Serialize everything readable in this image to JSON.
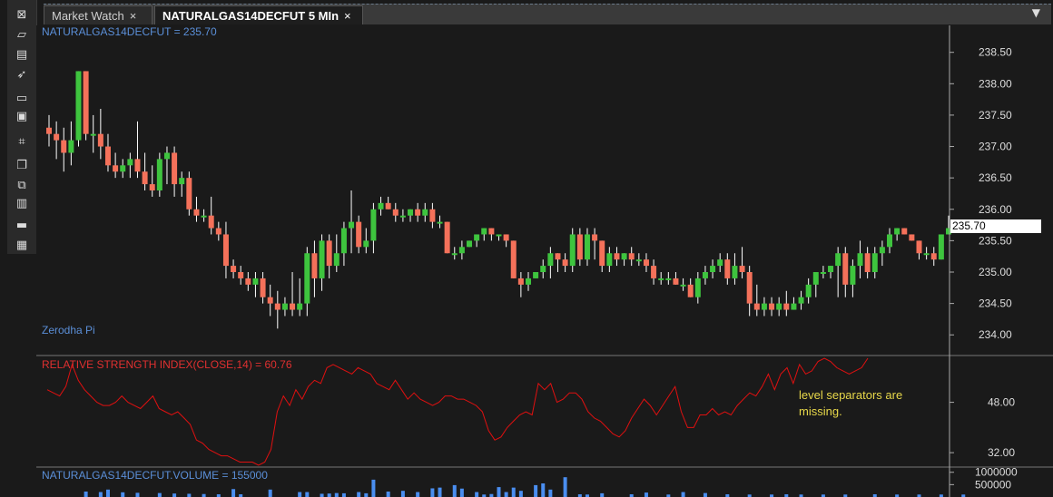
{
  "tabs": [
    {
      "label": "Market Watch",
      "close": "×",
      "active": false
    },
    {
      "label": "NATURALGAS14DECFUT 5 MIn",
      "close": "×",
      "active": true
    }
  ],
  "dropdown_icon": "chevron-down-icon",
  "toolbar": {
    "icons": [
      "close-window-icon",
      "open-folder-icon",
      "chart-icon",
      "rocket-icon",
      "window-icon",
      "save-icon",
      "crosshair-icon",
      "book-icon",
      "reading-icon",
      "briefcase-icon",
      "bar-icon",
      "list-icon"
    ]
  },
  "price_panel": {
    "title": "NATURALGAS14DECFUT = 235.70",
    "watermark": "Zerodha Pi",
    "current_price": "235.70",
    "axis_labels": [
      "238.50",
      "238.00",
      "237.50",
      "237.00",
      "236.50",
      "236.00",
      "235.50",
      "235.00",
      "234.50",
      "234.00"
    ]
  },
  "rsi_panel": {
    "title": "RELATIVE STRENGTH INDEX(CLOSE,14) = 60.76",
    "axis_labels": [
      "48.00",
      "32.00"
    ]
  },
  "volume_panel": {
    "title": "NATURALGAS14DECFUT.VOLUME = 155000",
    "axis_labels": [
      "1000000",
      "500000"
    ]
  },
  "annotation": "level separators are missing.",
  "colors": {
    "up": "#3ec43e",
    "down": "#f4715a",
    "rsi": "#e01010",
    "volume": "#4a8ef0",
    "price_title": "#5b8fd8",
    "rsi_title": "#e03030"
  },
  "chart_data": [
    {
      "type": "candlestick",
      "title": "NATURALGAS14DECFUT = 235.70",
      "ylim": [
        233.7,
        238.9
      ],
      "candles": [
        [
          237.3,
          237.5,
          237.0,
          237.2
        ],
        [
          237.2,
          237.4,
          236.8,
          237.1
        ],
        [
          237.1,
          237.3,
          236.6,
          236.9
        ],
        [
          236.9,
          237.4,
          236.7,
          237.1
        ],
        [
          237.1,
          238.2,
          237.0,
          238.2
        ],
        [
          238.2,
          238.2,
          237.1,
          237.2
        ],
        [
          237.2,
          237.5,
          236.9,
          237.2
        ],
        [
          237.2,
          237.6,
          236.8,
          237.0
        ],
        [
          237.0,
          237.2,
          236.6,
          236.7
        ],
        [
          236.7,
          236.9,
          236.5,
          236.6
        ],
        [
          236.6,
          236.8,
          236.5,
          236.7
        ],
        [
          236.7,
          236.9,
          236.5,
          236.8
        ],
        [
          236.8,
          237.4,
          236.5,
          236.6
        ],
        [
          236.6,
          236.9,
          236.3,
          236.4
        ],
        [
          236.4,
          236.7,
          236.2,
          236.3
        ],
        [
          236.3,
          236.9,
          236.2,
          236.8
        ],
        [
          236.8,
          237.0,
          236.4,
          236.9
        ],
        [
          236.9,
          237.0,
          236.2,
          236.4
        ],
        [
          236.4,
          236.6,
          236.2,
          236.5
        ],
        [
          236.5,
          236.6,
          235.9,
          236.0
        ],
        [
          236.0,
          236.2,
          235.8,
          235.9
        ],
        [
          235.9,
          236.0,
          235.8,
          235.9
        ],
        [
          235.9,
          236.2,
          235.6,
          235.7
        ],
        [
          235.7,
          235.8,
          235.5,
          235.6
        ],
        [
          235.6,
          235.8,
          234.9,
          235.1
        ],
        [
          235.1,
          235.2,
          234.9,
          235.0
        ],
        [
          235.0,
          235.1,
          234.8,
          234.9
        ],
        [
          234.9,
          235.0,
          234.7,
          234.8
        ],
        [
          234.8,
          235.0,
          234.6,
          234.9
        ],
        [
          234.9,
          235.0,
          234.5,
          234.6
        ],
        [
          234.6,
          234.8,
          234.3,
          234.5
        ],
        [
          234.5,
          234.7,
          234.1,
          234.4
        ],
        [
          234.4,
          234.6,
          234.3,
          234.5
        ],
        [
          234.5,
          235.0,
          234.3,
          234.4
        ],
        [
          234.4,
          234.9,
          234.3,
          234.5
        ],
        [
          234.5,
          235.4,
          234.3,
          235.3
        ],
        [
          235.3,
          235.5,
          234.6,
          234.9
        ],
        [
          234.9,
          235.6,
          234.7,
          235.5
        ],
        [
          235.5,
          235.6,
          234.9,
          235.1
        ],
        [
          235.1,
          235.6,
          235.0,
          235.3
        ],
        [
          235.3,
          235.8,
          235.1,
          235.7
        ],
        [
          235.7,
          236.3,
          235.3,
          235.8
        ],
        [
          235.8,
          235.9,
          235.3,
          235.4
        ],
        [
          235.4,
          235.7,
          235.3,
          235.5
        ],
        [
          235.5,
          236.1,
          235.3,
          236.0
        ],
        [
          236.0,
          236.2,
          235.9,
          236.1
        ],
        [
          236.1,
          236.2,
          236.0,
          236.0
        ],
        [
          236.0,
          236.1,
          235.8,
          235.9
        ],
        [
          235.9,
          236.0,
          235.8,
          235.9
        ],
        [
          235.9,
          236.0,
          235.8,
          236.0
        ],
        [
          236.0,
          236.1,
          235.8,
          235.9
        ],
        [
          235.9,
          236.1,
          235.8,
          236.0
        ],
        [
          236.0,
          236.1,
          235.7,
          235.8
        ],
        [
          235.8,
          235.9,
          235.7,
          235.8
        ],
        [
          235.8,
          235.8,
          235.3,
          235.3
        ],
        [
          235.3,
          235.4,
          235.2,
          235.3
        ],
        [
          235.3,
          235.5,
          235.2,
          235.4
        ],
        [
          235.4,
          235.5,
          235.4,
          235.5
        ],
        [
          235.5,
          235.6,
          235.4,
          235.6
        ],
        [
          235.6,
          235.7,
          235.5,
          235.7
        ],
        [
          235.7,
          235.7,
          235.5,
          235.6
        ],
        [
          235.6,
          235.6,
          235.5,
          235.6
        ],
        [
          235.6,
          235.6,
          235.4,
          235.5
        ],
        [
          235.5,
          235.5,
          234.9,
          234.9
        ],
        [
          234.9,
          235.0,
          234.6,
          234.8
        ],
        [
          234.8,
          235.0,
          234.7,
          234.9
        ],
        [
          234.9,
          235.0,
          234.9,
          235.0
        ],
        [
          235.0,
          235.2,
          234.9,
          235.1
        ],
        [
          235.1,
          235.4,
          234.9,
          235.3
        ],
        [
          235.3,
          235.3,
          235.0,
          235.2
        ],
        [
          235.2,
          235.3,
          235.0,
          235.1
        ],
        [
          235.1,
          235.7,
          235.0,
          235.6
        ],
        [
          235.6,
          235.7,
          235.1,
          235.2
        ],
        [
          235.2,
          235.7,
          235.1,
          235.6
        ],
        [
          235.6,
          235.7,
          235.2,
          235.5
        ],
        [
          235.5,
          235.5,
          235.0,
          235.1
        ],
        [
          235.1,
          235.4,
          235.0,
          235.3
        ],
        [
          235.3,
          235.4,
          235.1,
          235.2
        ],
        [
          235.2,
          235.3,
          235.1,
          235.3
        ],
        [
          235.3,
          235.4,
          235.1,
          235.2
        ],
        [
          235.2,
          235.3,
          235.1,
          235.2
        ],
        [
          235.2,
          235.3,
          235.0,
          235.1
        ],
        [
          235.1,
          235.2,
          234.8,
          234.9
        ],
        [
          234.9,
          235.0,
          234.8,
          234.9
        ],
        [
          234.9,
          235.0,
          234.8,
          234.9
        ],
        [
          234.9,
          235.0,
          234.8,
          234.8
        ],
        [
          234.8,
          234.9,
          234.7,
          234.8
        ],
        [
          234.8,
          234.9,
          234.6,
          234.6
        ],
        [
          234.6,
          235.0,
          234.5,
          234.9
        ],
        [
          234.9,
          235.1,
          234.8,
          235.0
        ],
        [
          235.0,
          235.2,
          234.9,
          235.1
        ],
        [
          235.1,
          235.3,
          235.0,
          235.2
        ],
        [
          235.2,
          235.3,
          234.8,
          234.9
        ],
        [
          234.9,
          235.3,
          234.8,
          235.1
        ],
        [
          235.1,
          235.4,
          234.9,
          235.0
        ],
        [
          235.0,
          235.1,
          234.3,
          234.5
        ],
        [
          234.5,
          234.8,
          234.3,
          234.4
        ],
        [
          234.4,
          234.6,
          234.3,
          234.5
        ],
        [
          234.5,
          234.6,
          234.3,
          234.4
        ],
        [
          234.4,
          234.6,
          234.3,
          234.5
        ],
        [
          234.5,
          234.7,
          234.3,
          234.4
        ],
        [
          234.4,
          234.6,
          234.4,
          234.5
        ],
        [
          234.5,
          234.7,
          234.4,
          234.6
        ],
        [
          234.6,
          234.9,
          234.5,
          234.8
        ],
        [
          234.8,
          235.0,
          234.6,
          235.0
        ],
        [
          235.0,
          235.1,
          234.9,
          235.0
        ],
        [
          235.0,
          235.1,
          234.9,
          235.1
        ],
        [
          235.1,
          235.4,
          234.6,
          235.3
        ],
        [
          235.3,
          235.4,
          234.6,
          234.8
        ],
        [
          234.8,
          235.2,
          234.6,
          235.1
        ],
        [
          235.1,
          235.5,
          234.9,
          235.3
        ],
        [
          235.3,
          235.4,
          234.9,
          235.0
        ],
        [
          235.0,
          235.4,
          234.9,
          235.3
        ],
        [
          235.3,
          235.5,
          235.1,
          235.4
        ],
        [
          235.4,
          235.7,
          235.3,
          235.6
        ],
        [
          235.6,
          235.7,
          235.5,
          235.7
        ],
        [
          235.7,
          235.7,
          235.6,
          235.6
        ],
        [
          235.6,
          235.6,
          235.5,
          235.5
        ],
        [
          235.5,
          235.5,
          235.2,
          235.3
        ],
        [
          235.3,
          235.4,
          235.2,
          235.3
        ],
        [
          235.3,
          235.4,
          235.1,
          235.2
        ],
        [
          235.2,
          235.6,
          235.2,
          235.6
        ],
        [
          235.6,
          235.9,
          235.6,
          235.7
        ]
      ]
    },
    {
      "type": "line",
      "title": "RELATIVE STRENGTH INDEX(CLOSE,14) = 60.76",
      "ylim": [
        28,
        62
      ],
      "values": [
        52,
        51,
        50,
        53,
        60,
        55,
        52,
        50,
        48,
        47,
        47,
        48,
        50,
        48,
        47,
        46,
        48,
        50,
        46,
        45,
        44,
        45,
        43,
        41,
        36,
        35,
        33,
        32,
        31,
        31,
        30,
        29,
        29,
        29,
        28,
        29,
        33,
        45,
        50,
        47,
        52,
        49,
        53,
        55,
        54,
        59,
        60,
        59,
        58,
        57,
        59,
        58,
        57,
        54,
        53,
        52,
        55,
        52,
        49,
        51,
        49,
        48,
        47,
        48,
        50,
        50,
        49,
        49,
        48,
        47,
        45,
        39,
        36,
        37,
        40,
        42,
        44,
        45,
        44,
        54,
        52,
        54,
        48,
        49,
        51,
        51,
        49,
        45,
        43,
        42,
        40,
        38,
        37,
        39,
        43,
        46,
        49,
        47,
        44,
        47,
        50,
        53,
        45,
        40,
        40,
        44,
        44,
        46,
        44,
        45,
        44,
        47,
        49,
        51,
        50,
        53,
        57,
        52,
        57,
        59,
        54,
        60,
        57,
        58,
        61,
        62,
        61,
        59,
        58,
        57,
        58,
        59,
        62
      ],
      "level_separators": false
    },
    {
      "type": "bar",
      "title": "NATURALGAS14DECFUT.VOLUME = 155000",
      "ylim": [
        0,
        1100000
      ],
      "bars": [
        [
          5,
          220000
        ],
        [
          7,
          200000
        ],
        [
          8,
          300000
        ],
        [
          10,
          190000
        ],
        [
          12,
          170000
        ],
        [
          15,
          160000
        ],
        [
          17,
          140000
        ],
        [
          19,
          130000
        ],
        [
          21,
          120000
        ],
        [
          23,
          110000
        ],
        [
          25,
          320000
        ],
        [
          26,
          110000
        ],
        [
          30,
          300000
        ],
        [
          34,
          200000
        ],
        [
          35,
          200000
        ],
        [
          37,
          130000
        ],
        [
          38,
          140000
        ],
        [
          39,
          160000
        ],
        [
          40,
          150000
        ],
        [
          42,
          200000
        ],
        [
          43,
          150000
        ],
        [
          44,
          700000
        ],
        [
          46,
          220000
        ],
        [
          48,
          250000
        ],
        [
          50,
          200000
        ],
        [
          52,
          350000
        ],
        [
          53,
          380000
        ],
        [
          55,
          480000
        ],
        [
          56,
          340000
        ],
        [
          58,
          200000
        ],
        [
          59,
          100000
        ],
        [
          60,
          120000
        ],
        [
          61,
          400000
        ],
        [
          62,
          200000
        ],
        [
          63,
          380000
        ],
        [
          64,
          250000
        ],
        [
          66,
          480000
        ],
        [
          67,
          550000
        ],
        [
          68,
          300000
        ],
        [
          70,
          800000
        ],
        [
          72,
          110000
        ],
        [
          73,
          100000
        ],
        [
          75,
          150000
        ],
        [
          79,
          110000
        ],
        [
          81,
          180000
        ],
        [
          84,
          100000
        ],
        [
          86,
          200000
        ],
        [
          89,
          160000
        ],
        [
          92,
          110000
        ],
        [
          95,
          100000
        ],
        [
          98,
          100000
        ],
        [
          100,
          110000
        ],
        [
          102,
          100000
        ],
        [
          105,
          100000
        ],
        [
          108,
          100000
        ],
        [
          112,
          110000
        ],
        [
          115,
          100000
        ],
        [
          118,
          100000
        ],
        [
          121,
          100000
        ],
        [
          124,
          100000
        ]
      ]
    }
  ]
}
